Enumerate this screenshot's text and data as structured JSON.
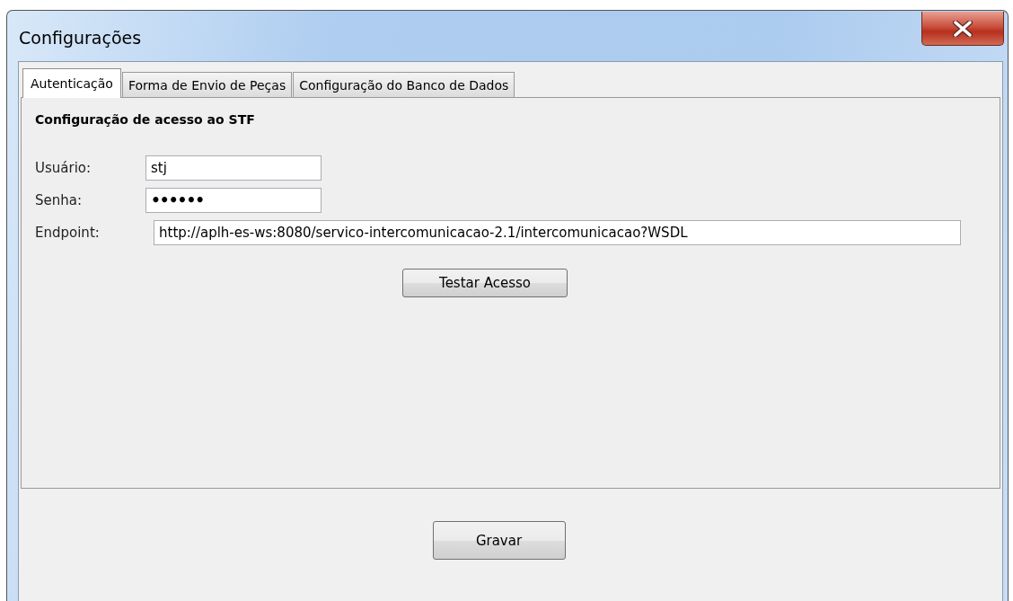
{
  "window": {
    "title": "Configurações"
  },
  "tabs": [
    {
      "label": "Autenticação",
      "selected": true
    },
    {
      "label": "Forma de Envio de Peças",
      "selected": false
    },
    {
      "label": "Configuração do Banco de Dados",
      "selected": false
    }
  ],
  "section_title": "Configuração de acesso ao STF",
  "fields": [
    {
      "label": "Usuário:",
      "value": "stj",
      "kind": "text"
    },
    {
      "label": "Senha:",
      "value": "••••••",
      "kind": "password"
    },
    {
      "label": "Endpoint:",
      "value": "http://aplh-es-ws:8080/servico-intercomunicacao-2.1/intercomunicacao?WSDL",
      "kind": "url"
    }
  ],
  "test_button": "Testar Acesso",
  "save_button": "Gravar"
}
